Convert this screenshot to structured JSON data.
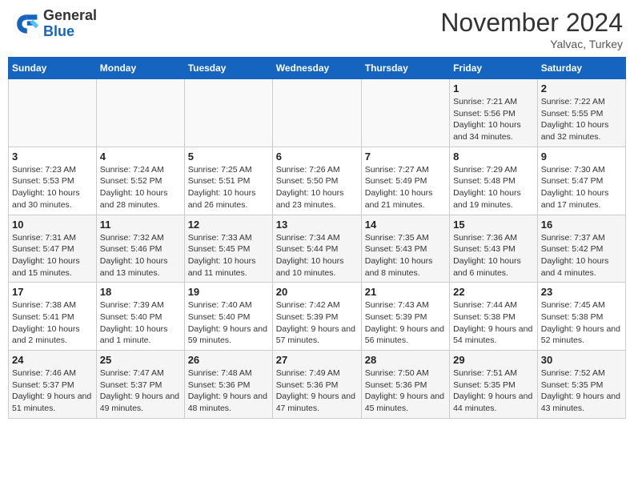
{
  "header": {
    "logo_general": "General",
    "logo_blue": "Blue",
    "month_title": "November 2024",
    "location": "Yalvac, Turkey"
  },
  "weekdays": [
    "Sunday",
    "Monday",
    "Tuesday",
    "Wednesday",
    "Thursday",
    "Friday",
    "Saturday"
  ],
  "weeks": [
    [
      {
        "day": "",
        "info": ""
      },
      {
        "day": "",
        "info": ""
      },
      {
        "day": "",
        "info": ""
      },
      {
        "day": "",
        "info": ""
      },
      {
        "day": "",
        "info": ""
      },
      {
        "day": "1",
        "info": "Sunrise: 7:21 AM\nSunset: 5:56 PM\nDaylight: 10 hours and 34 minutes."
      },
      {
        "day": "2",
        "info": "Sunrise: 7:22 AM\nSunset: 5:55 PM\nDaylight: 10 hours and 32 minutes."
      }
    ],
    [
      {
        "day": "3",
        "info": "Sunrise: 7:23 AM\nSunset: 5:53 PM\nDaylight: 10 hours and 30 minutes."
      },
      {
        "day": "4",
        "info": "Sunrise: 7:24 AM\nSunset: 5:52 PM\nDaylight: 10 hours and 28 minutes."
      },
      {
        "day": "5",
        "info": "Sunrise: 7:25 AM\nSunset: 5:51 PM\nDaylight: 10 hours and 26 minutes."
      },
      {
        "day": "6",
        "info": "Sunrise: 7:26 AM\nSunset: 5:50 PM\nDaylight: 10 hours and 23 minutes."
      },
      {
        "day": "7",
        "info": "Sunrise: 7:27 AM\nSunset: 5:49 PM\nDaylight: 10 hours and 21 minutes."
      },
      {
        "day": "8",
        "info": "Sunrise: 7:29 AM\nSunset: 5:48 PM\nDaylight: 10 hours and 19 minutes."
      },
      {
        "day": "9",
        "info": "Sunrise: 7:30 AM\nSunset: 5:47 PM\nDaylight: 10 hours and 17 minutes."
      }
    ],
    [
      {
        "day": "10",
        "info": "Sunrise: 7:31 AM\nSunset: 5:47 PM\nDaylight: 10 hours and 15 minutes."
      },
      {
        "day": "11",
        "info": "Sunrise: 7:32 AM\nSunset: 5:46 PM\nDaylight: 10 hours and 13 minutes."
      },
      {
        "day": "12",
        "info": "Sunrise: 7:33 AM\nSunset: 5:45 PM\nDaylight: 10 hours and 11 minutes."
      },
      {
        "day": "13",
        "info": "Sunrise: 7:34 AM\nSunset: 5:44 PM\nDaylight: 10 hours and 10 minutes."
      },
      {
        "day": "14",
        "info": "Sunrise: 7:35 AM\nSunset: 5:43 PM\nDaylight: 10 hours and 8 minutes."
      },
      {
        "day": "15",
        "info": "Sunrise: 7:36 AM\nSunset: 5:43 PM\nDaylight: 10 hours and 6 minutes."
      },
      {
        "day": "16",
        "info": "Sunrise: 7:37 AM\nSunset: 5:42 PM\nDaylight: 10 hours and 4 minutes."
      }
    ],
    [
      {
        "day": "17",
        "info": "Sunrise: 7:38 AM\nSunset: 5:41 PM\nDaylight: 10 hours and 2 minutes."
      },
      {
        "day": "18",
        "info": "Sunrise: 7:39 AM\nSunset: 5:40 PM\nDaylight: 10 hours and 1 minute."
      },
      {
        "day": "19",
        "info": "Sunrise: 7:40 AM\nSunset: 5:40 PM\nDaylight: 9 hours and 59 minutes."
      },
      {
        "day": "20",
        "info": "Sunrise: 7:42 AM\nSunset: 5:39 PM\nDaylight: 9 hours and 57 minutes."
      },
      {
        "day": "21",
        "info": "Sunrise: 7:43 AM\nSunset: 5:39 PM\nDaylight: 9 hours and 56 minutes."
      },
      {
        "day": "22",
        "info": "Sunrise: 7:44 AM\nSunset: 5:38 PM\nDaylight: 9 hours and 54 minutes."
      },
      {
        "day": "23",
        "info": "Sunrise: 7:45 AM\nSunset: 5:38 PM\nDaylight: 9 hours and 52 minutes."
      }
    ],
    [
      {
        "day": "24",
        "info": "Sunrise: 7:46 AM\nSunset: 5:37 PM\nDaylight: 9 hours and 51 minutes."
      },
      {
        "day": "25",
        "info": "Sunrise: 7:47 AM\nSunset: 5:37 PM\nDaylight: 9 hours and 49 minutes."
      },
      {
        "day": "26",
        "info": "Sunrise: 7:48 AM\nSunset: 5:36 PM\nDaylight: 9 hours and 48 minutes."
      },
      {
        "day": "27",
        "info": "Sunrise: 7:49 AM\nSunset: 5:36 PM\nDaylight: 9 hours and 47 minutes."
      },
      {
        "day": "28",
        "info": "Sunrise: 7:50 AM\nSunset: 5:36 PM\nDaylight: 9 hours and 45 minutes."
      },
      {
        "day": "29",
        "info": "Sunrise: 7:51 AM\nSunset: 5:35 PM\nDaylight: 9 hours and 44 minutes."
      },
      {
        "day": "30",
        "info": "Sunrise: 7:52 AM\nSunset: 5:35 PM\nDaylight: 9 hours and 43 minutes."
      }
    ]
  ]
}
